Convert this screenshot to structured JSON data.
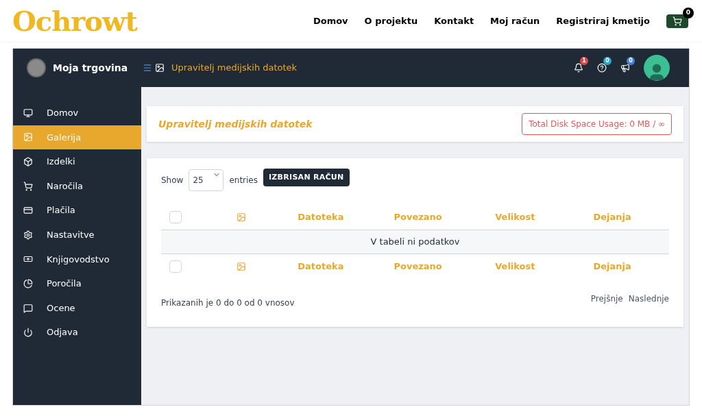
{
  "site": {
    "logo": "Ochrowt",
    "nav": [
      "Domov",
      "O projektu",
      "Kontakt",
      "Moj račun",
      "Registriraj kmetijo"
    ],
    "cart_count": "0"
  },
  "topbar": {
    "store_name": "Moja trgovina",
    "breadcrumb": "Upravitelj medijskih datotek",
    "notifications": [
      {
        "kind": "bell",
        "count": "1",
        "color": "#e04848"
      },
      {
        "kind": "help",
        "count": "0",
        "color": "#2aa7c9"
      },
      {
        "kind": "announce",
        "count": "0",
        "color": "#4a7fd6"
      }
    ]
  },
  "sidebar": {
    "items": [
      {
        "kind": "home",
        "label": "Domov",
        "selected": false
      },
      {
        "kind": "gallery",
        "label": "Galerija",
        "selected": true
      },
      {
        "kind": "products",
        "label": "Izdelki",
        "selected": false
      },
      {
        "kind": "orders",
        "label": "Naročila",
        "selected": false
      },
      {
        "kind": "payments",
        "label": "Plačila",
        "selected": false
      },
      {
        "kind": "settings",
        "label": "Nastavitve",
        "selected": false
      },
      {
        "kind": "accounting",
        "label": "Knjigovodstvo",
        "selected": false
      },
      {
        "kind": "reports",
        "label": "Poročila",
        "selected": false
      },
      {
        "kind": "reviews",
        "label": "Ocene",
        "selected": false
      },
      {
        "kind": "logout",
        "label": "Odjava",
        "selected": false
      }
    ]
  },
  "page": {
    "title": "Upravitelj medijskih datotek",
    "disk_usage": "Total Disk Space Usage: 0 MB / ∞"
  },
  "table": {
    "show_label": "Show",
    "page_size": "25",
    "entries_label": "entries",
    "action_button": "IZBRISAN RAČUN",
    "header": {
      "checked": false,
      "columns": [
        "Datoteka",
        "Povezano",
        "Velikost",
        "Dejanja"
      ]
    },
    "empty_message": "V tabeli ni podatkov",
    "footer": {
      "checked": false,
      "columns": [
        "Datoteka",
        "Povezano",
        "Velikost",
        "Dejanja"
      ]
    },
    "info": "Prikazanih je 0 do 0 od 0 vnosov",
    "pagination": [
      "Prejšnje",
      "Naslednje"
    ]
  }
}
